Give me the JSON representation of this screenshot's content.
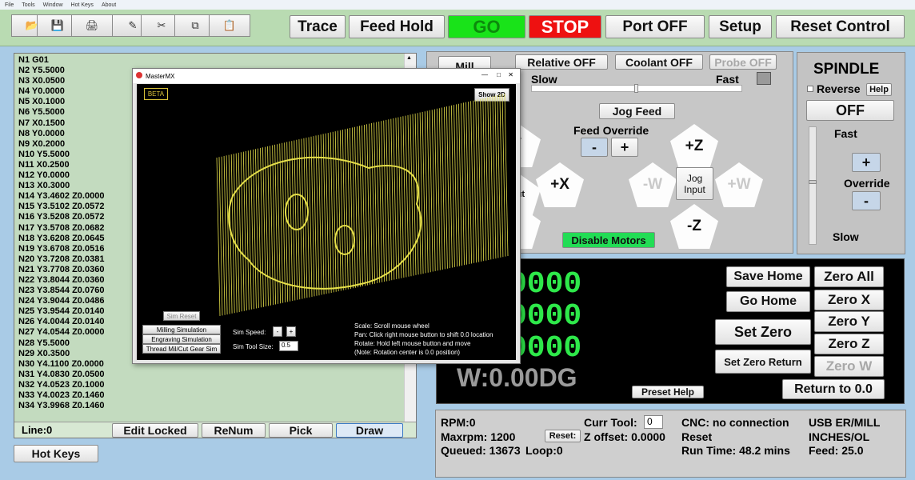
{
  "menu": [
    "File",
    "Tools",
    "Window",
    "Hot Keys",
    "About"
  ],
  "toolbar": {
    "icons": [
      "open-folder-icon",
      "save-disk-icon",
      "print-icon",
      "edit-pencil-icon",
      "cut-scissors-icon",
      "copy-icon",
      "paste-icon"
    ],
    "trace": "Trace",
    "feed_hold": "Feed Hold",
    "go": "GO",
    "stop": "STOP",
    "port": "Port OFF",
    "setup": "Setup",
    "reset_control": "Reset Control",
    "go_color": "#19e319",
    "stop_color": "#ee1111"
  },
  "gcode": {
    "lines": [
      "N1 G01",
      "N2 Y5.5000",
      "N3 X0.0500",
      "N4 Y0.0000",
      "N5 X0.1000",
      "N6 Y5.5000",
      "N7 X0.1500",
      "N8 Y0.0000",
      "N9 X0.2000",
      "N10 Y5.5000",
      "N11 X0.2500",
      "N12 Y0.0000",
      "N13 X0.3000",
      "N14 Y3.4602 Z0.0000",
      "N15 Y3.5102 Z0.0572",
      "N16 Y3.5208 Z0.0572",
      "N17 Y3.5708 Z0.0682",
      "N18 Y3.6208 Z0.0645",
      "N19 Y3.6708 Z0.0516",
      "N20 Y3.7208 Z0.0381",
      "N21 Y3.7708 Z0.0360",
      "N22 Y3.8044 Z0.0360",
      "N23 Y3.8544 Z0.0760",
      "N24 Y3.9044 Z0.0486",
      "N25 Y3.9544 Z0.0140",
      "N26 Y4.0044 Z0.0140",
      "N27 Y4.0544 Z0.0000",
      "N28 Y5.5000",
      "N29 X0.3500",
      "N30 Y4.1100 Z0.0000",
      "N31 Y4.0830 Z0.0500",
      "N32 Y4.0523 Z0.1000",
      "N33 Y4.0023 Z0.1460",
      "N34 Y3.9968 Z0.1460"
    ],
    "line_label": "Line:0",
    "edit_locked": "Edit Locked",
    "renum": "ReNum",
    "pick": "Pick",
    "draw": "Draw"
  },
  "hot_keys": "Hot Keys",
  "jog": {
    "mill_tab": "Mill",
    "relative": "Relative OFF",
    "coolant": "Coolant OFF",
    "probe": "Probe OFF",
    "slow": "Slow",
    "fast": "Fast",
    "jog_feed": "Jog Feed",
    "feed_override": "Feed Override",
    "minus": "-",
    "plus": "+",
    "y_plus": "Y",
    "x_minus": "g\nut",
    "x_plus": "+X",
    "y_minus": "/",
    "z_plus": "+Z",
    "z_minus": "-Z",
    "w_minus": "-W",
    "w_plus": "+W",
    "jog_input": "Jog Input",
    "disable_motors": "Disable Motors",
    "disable_color": "#22dd55"
  },
  "spindle": {
    "title": "SPINDLE",
    "reverse": "Reverse",
    "help": "Help",
    "off": "OFF",
    "fast": "Fast",
    "plus": "+",
    "override": "Override",
    "minus": "-",
    "slow": "Slow"
  },
  "dro": {
    "x": "0000",
    "y": "0000",
    "z": "0000",
    "w": "W:0.00DG",
    "save_home": "Save Home",
    "go_home": "Go Home",
    "set_zero": "Set Zero",
    "set_zero_return": "Set Zero Return",
    "zero_all": "Zero All",
    "zero_x": "Zero X",
    "zero_y": "Zero Y",
    "zero_z": "Zero Z",
    "zero_w": "Zero W",
    "return": "Return to 0.0",
    "preset_help": "Preset Help",
    "digit_color": "#2ee84a"
  },
  "status": {
    "rpm": "RPM:0",
    "maxrpm": "Maxrpm: 1200",
    "queued": "Queued: 13673",
    "loop": "Loop:0",
    "curr_tool_label": "Curr Tool:",
    "curr_tool_value": "0",
    "reset": "Reset:",
    "z_offset": "Z offset: 0.0000",
    "cnc": "CNC: no connection",
    "reset2": "Reset",
    "runtime": "Run Time: 48.2 mins",
    "usb": "USB ER/MILL",
    "inches": "INCHES/OL",
    "feed": "Feed: 25.0"
  },
  "sim": {
    "title": "MasterMX",
    "beta": "BETA",
    "show2d": "Show 2D",
    "sim_reset": "Sim Reset",
    "milling": "Milling Simulation",
    "engraving": "Engraving Simulation",
    "thread": "Thread Mil/Cut Gear Sim",
    "speed_label": "Sim Speed:",
    "speed_minus": "-",
    "speed_plus": "+",
    "tool_label": "Sim Tool Size:",
    "tool_value": "0.5",
    "info": [
      "Scale: Scroll mouse wheel",
      "Pan: Click right mouse button to shift  0.0  location",
      "Rotate: Hold left mouse button and move",
      "   (Note: Rotation center is 0.0 position)"
    ],
    "wire_color": "#e6e04a"
  }
}
